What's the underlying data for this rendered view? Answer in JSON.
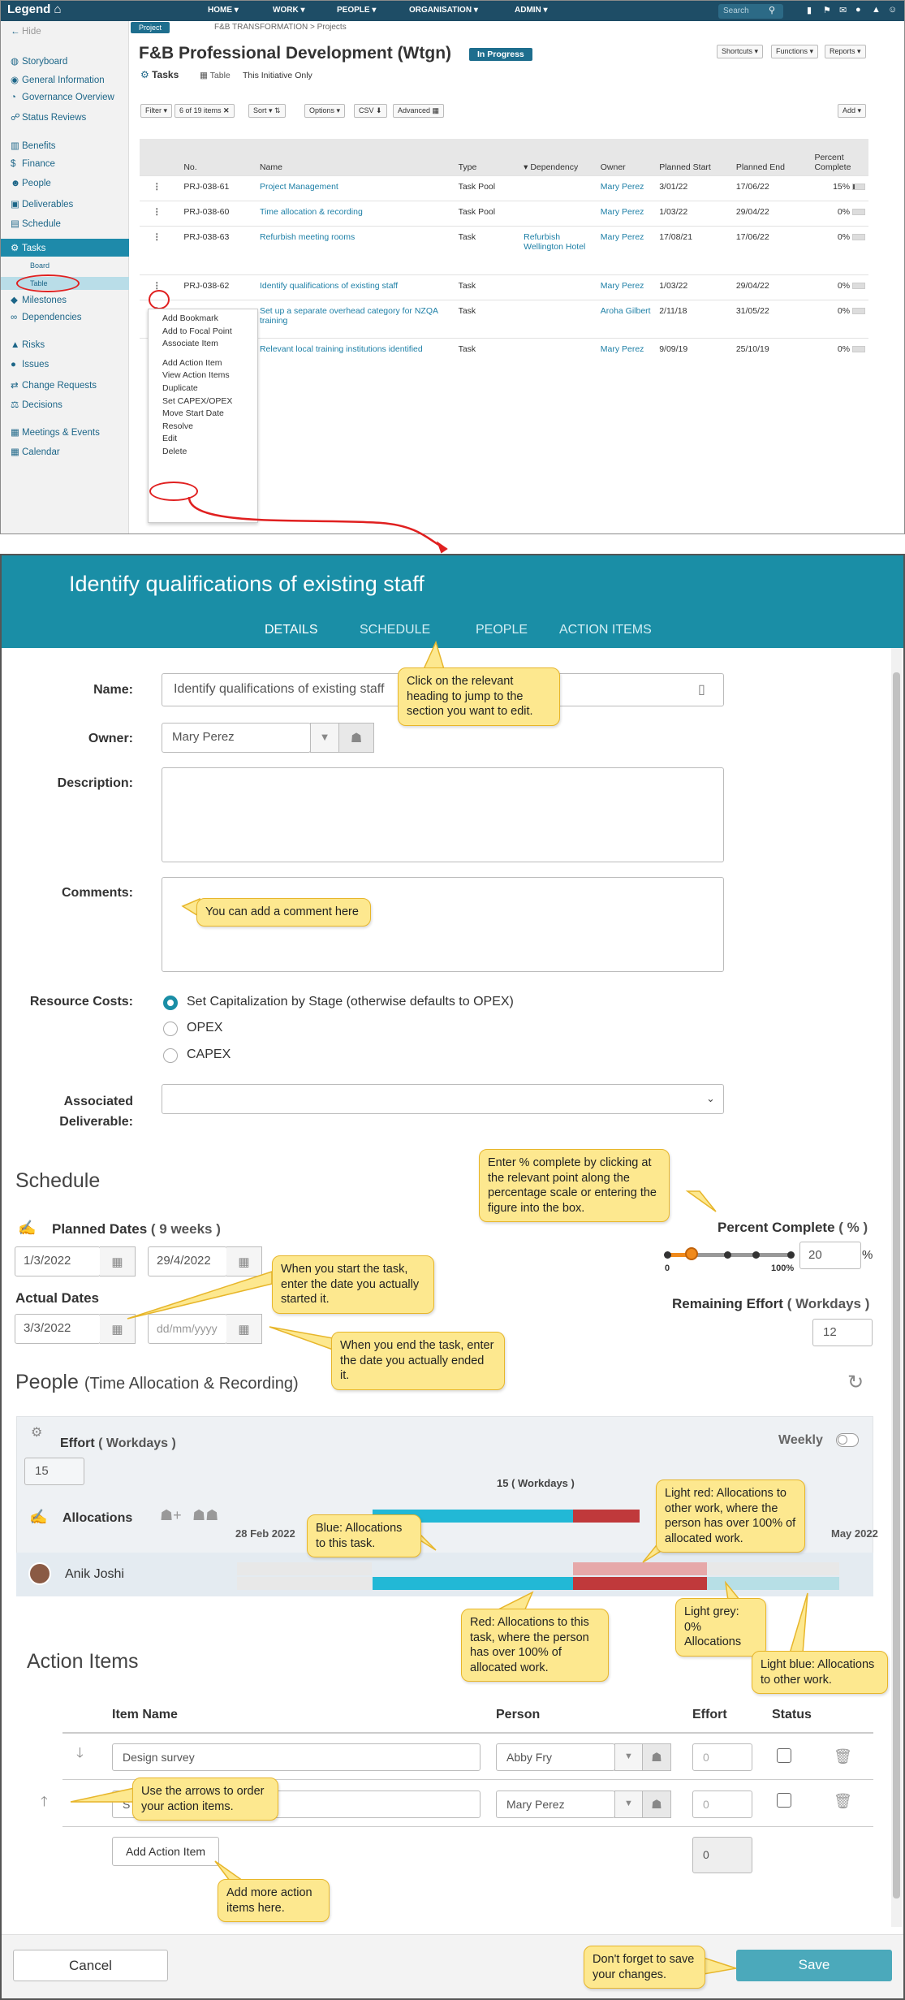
{
  "navbar": {
    "logo": "Legend",
    "menus": [
      "HOME ▾",
      "WORK ▾",
      "PEOPLE ▾",
      "ORGANISATION ▾",
      "ADMIN ▾"
    ],
    "search": "Search"
  },
  "sidebar": {
    "hide": "Hide",
    "items": [
      "Storyboard",
      "General Information",
      "Governance Overview",
      "Status Reviews",
      "Benefits",
      "Finance",
      "People",
      "Deliverables",
      "Schedule",
      "Tasks",
      "Board",
      "Table",
      "Milestones",
      "Dependencies",
      "Risks",
      "Issues",
      "Change Requests",
      "Decisions",
      "Meetings & Events",
      "Calendar"
    ]
  },
  "page": {
    "tag": "Project",
    "breadcrumb": "F&B TRANSFORMATION > Projects",
    "title": "F&B Professional Development (Wtgn)",
    "status": "In Progress",
    "sub_title": "Tasks",
    "view": "Table",
    "scope": "This Initiative Only",
    "top_buttons": [
      "Shortcuts ▾",
      "Functions ▾",
      "Reports ▾"
    ]
  },
  "toolbar": {
    "filter": "Filter ▾",
    "count": "6 of 19 items",
    "sort": "Sort ▾",
    "options": "Options ▾",
    "csv": "CSV",
    "advanced": "Advanced",
    "add": "Add ▾"
  },
  "table": {
    "headers": [
      "No.",
      "Name",
      "Type",
      "Dependency",
      "Owner",
      "Planned Start",
      "Planned End",
      "Percent Complete"
    ],
    "rows": [
      {
        "no": "PRJ-038-61",
        "name": "Project Management",
        "type": "Task Pool",
        "dep": "",
        "owner": "Mary Perez",
        "start": "3/01/22",
        "end": "17/06/22",
        "pct": "15%"
      },
      {
        "no": "PRJ-038-60",
        "name": "Time allocation & recording",
        "type": "Task Pool",
        "dep": "",
        "owner": "Mary Perez",
        "start": "1/03/22",
        "end": "29/04/22",
        "pct": "0%"
      },
      {
        "no": "PRJ-038-63",
        "name": "Refurbish meeting rooms",
        "type": "Task",
        "dep": "Refurbish Wellington Hotel",
        "owner": "Mary Perez",
        "start": "17/08/21",
        "end": "17/06/22",
        "pct": "0%"
      },
      {
        "no": "PRJ-038-62",
        "name": "Identify qualifications of existing staff",
        "type": "Task",
        "dep": "",
        "owner": "Mary Perez",
        "start": "1/03/22",
        "end": "29/04/22",
        "pct": "0%"
      },
      {
        "no": "",
        "name": "Set up a separate overhead category for NZQA training",
        "type": "Task",
        "dep": "",
        "owner": "Aroha Gilbert",
        "start": "2/11/18",
        "end": "31/05/22",
        "pct": "0%"
      },
      {
        "no": "",
        "name": "Relevant local training institutions identified",
        "type": "Task",
        "dep": "",
        "owner": "Mary Perez",
        "start": "9/09/19",
        "end": "25/10/19",
        "pct": "0%"
      }
    ]
  },
  "context_menu": [
    "Add Bookmark",
    "Add to Focal Point",
    "Associate Item",
    "",
    "Add Action Item",
    "View Action Items",
    "Duplicate",
    "Set CAPEX/OPEX",
    "Move Start Date",
    "Resolve",
    "Edit",
    "Delete"
  ],
  "form": {
    "title": "Identify qualifications of existing staff",
    "tabs": [
      "DETAILS",
      "SCHEDULE",
      "PEOPLE",
      "ACTION ITEMS"
    ],
    "name_label": "Name:",
    "name_value": "Identify qualifications of existing staff",
    "owner_label": "Owner:",
    "owner_value": "Mary Perez",
    "desc_label": "Description:",
    "comments_label": "Comments:",
    "rc_label": "Resource Costs:",
    "rc_options": [
      "Set Capitalization by Stage (otherwise defaults to OPEX)",
      "OPEX",
      "CAPEX"
    ],
    "assoc_label_1": "Associated",
    "assoc_label_2": "Deliverable:",
    "schedule_heading": "Schedule",
    "planned_label": "Planned Dates",
    "planned_weeks": "( 9 weeks )",
    "planned_start": "1/3/2022",
    "planned_end": "29/4/2022",
    "actual_label": "Actual Dates",
    "actual_start": "3/3/2022",
    "actual_end_placeholder": "dd/mm/yyyy",
    "pc_label": "Percent Complete",
    "pc_unit": "( % )",
    "pc_value": "20",
    "pc_sign": "%",
    "pc_min": "0",
    "pc_max": "100%",
    "pc_fraction": 0.2,
    "re_label": "Remaining Effort",
    "re_unit": "( Workdays )",
    "re_value": "12",
    "people_heading": "People",
    "people_sub": "(Time Allocation & Recording)",
    "effort_label": "Effort",
    "effort_unit": "( Workdays )",
    "effort_value": "15",
    "weekly": "Weekly",
    "alloc_label": "Allocations",
    "alloc_total": "15 ( Workdays )",
    "date1": "28 Feb 2022",
    "date2": "May 2022",
    "person": "Anik Joshi",
    "ai_heading": "Action Items",
    "ai_headers": [
      "Item Name",
      "Person",
      "Effort",
      "Status"
    ],
    "ai_rows": [
      {
        "name": "Design survey",
        "person": "Abby Fry",
        "effort": "0"
      },
      {
        "name": "S",
        "person": "Mary Perez",
        "effort": "0"
      }
    ],
    "ai_add": "Add Action Item",
    "ai_total": "0",
    "cancel": "Cancel",
    "save": "Save"
  },
  "callouts": {
    "tabs": "Click on the relevant heading to jump to the section you want to edit.",
    "comment": "You can add a comment here",
    "pct": "Enter % complete by clicking at the relevant point along the percentage scale or entering the figure into the box.",
    "start": "When you start the task, enter the date you actually started it.",
    "end": "When you end the task, enter the date you actually ended it.",
    "blue": "Blue: Allocations to this task.",
    "lightred": "Light red: Allocations to other work, where the person has over 100% of allocated work.",
    "red": "Red: Allocations to this task, where the person has over 100% of allocated work.",
    "grey": "Light grey: 0% Allocations",
    "lightblue": "Light blue: Allocations to other work.",
    "arrows": "Use the arrows to order your action items.",
    "more": "Add more action items here.",
    "save": "Don't forget to save your changes."
  },
  "colors": {
    "nav": "#1e4d66",
    "teal": "#1a8ea6",
    "callout": "#fde88f",
    "red": "#e02020",
    "blue_alloc": "#22b8d6",
    "red_alloc": "#c0393b"
  }
}
